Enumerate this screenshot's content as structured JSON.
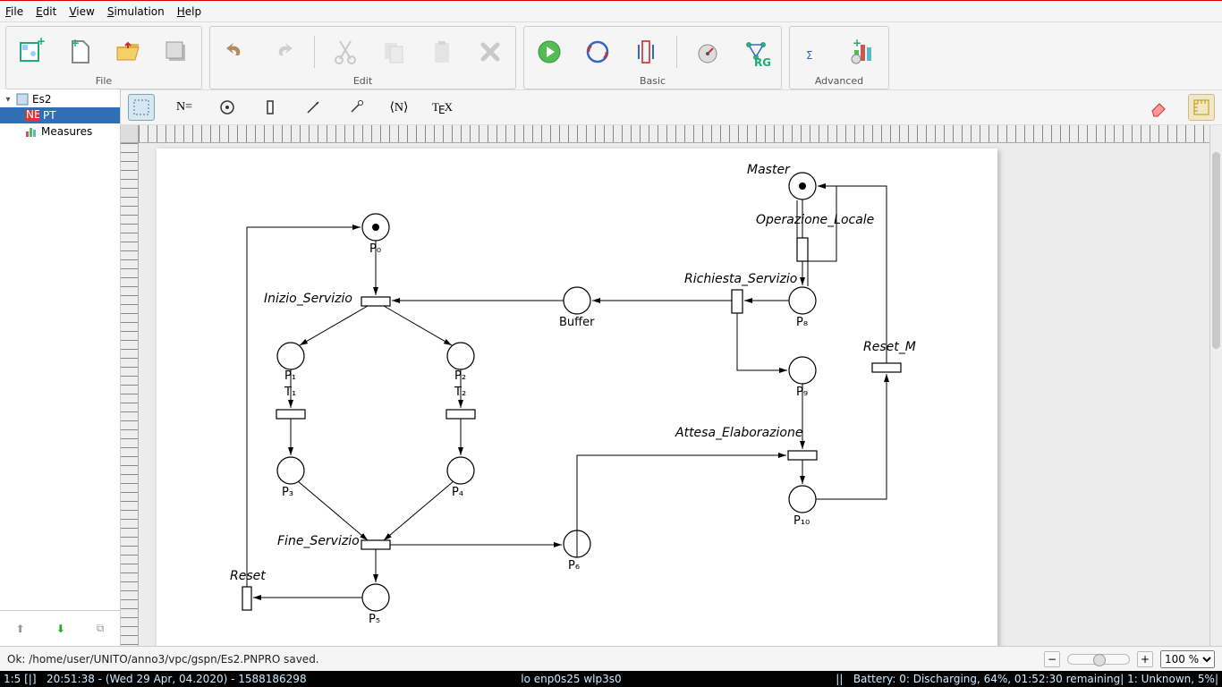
{
  "menu": {
    "file": "File",
    "edit": "Edit",
    "view": "View",
    "simulation": "Simulation",
    "help": "Help"
  },
  "toolbar_groups": {
    "file": "File",
    "edit": "Edit",
    "basic": "Basic",
    "advanced": "Advanced"
  },
  "tool2": {
    "name_eq": "N=",
    "angle": "⟨N⟩",
    "tex": "TEX"
  },
  "tree": {
    "root": "Es2",
    "items": [
      {
        "label": "PT",
        "selected": true
      },
      {
        "label": "Measures",
        "selected": false
      }
    ]
  },
  "net": {
    "places": {
      "P0": "P₀",
      "P1": "P₁",
      "P2": "P₂",
      "P3": "P₃",
      "P4": "P₄",
      "P5": "P₅",
      "P6": "P₆",
      "P8": "P₈",
      "P9": "P₉",
      "P10": "P₁₀",
      "Master": "Master",
      "Buffer": "Buffer"
    },
    "transitions": {
      "Inizio": "Inizio_Servizio",
      "T1": "T₁",
      "T2": "T₂",
      "Fine": "Fine_Servizio",
      "Reset": "Reset",
      "OpLoc": "Operazione_Locale",
      "RichServ": "Richiesta_Servizio",
      "Attesa": "Attesa_Elaborazione",
      "ResetM": "Reset_M"
    }
  },
  "status": {
    "msg": "Ok: /home/user/UNITO/anno3/vpc/gspn/Es2.PNPRO saved.",
    "zoom": "100 %"
  },
  "sysbar": {
    "left": "1:5 [|]   20:51:38 - (Wed 29 Apr, 04.2020) - 1588186298",
    "mid": "lo enp0s25 wlp3s0",
    "right": "||   Battery: 0: Discharging, 64%, 01:52:30 remaining| 1: Unknown, 5%|"
  }
}
